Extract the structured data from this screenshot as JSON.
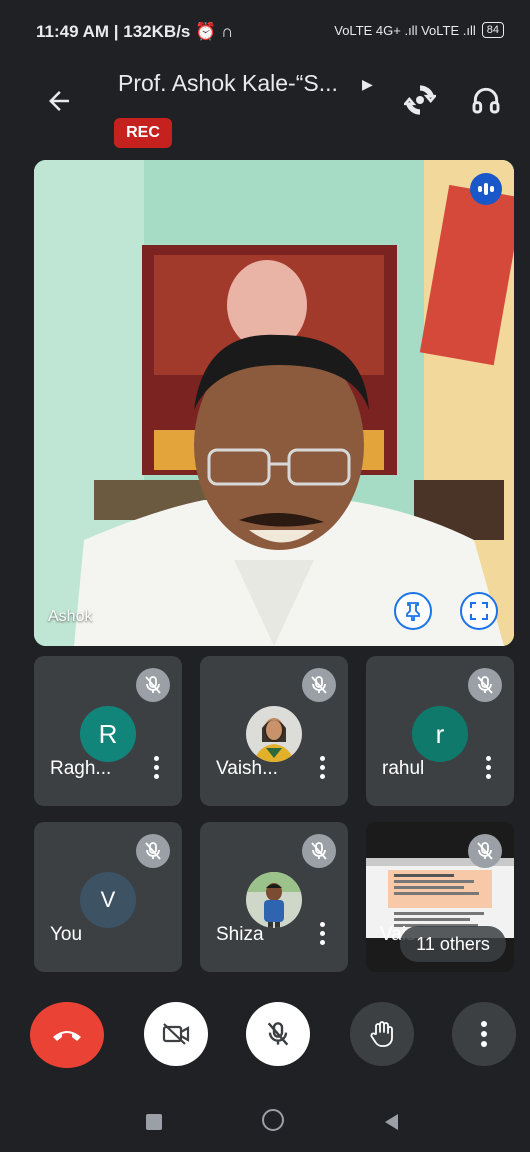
{
  "status_bar": {
    "time_text": "11:49 AM | 132KB/s",
    "network_text": "VoLTE 4G+ .ıll VoLTE .ıll",
    "battery": "84"
  },
  "header": {
    "title": "Prof. Ashok Kale-“S...",
    "rec_label": "REC"
  },
  "main_video": {
    "name": "Ashok"
  },
  "participants": [
    {
      "name": "Ragh...",
      "initial": "R",
      "color": "#12857a"
    },
    {
      "name": "Vaish...",
      "initial": "",
      "color": ""
    },
    {
      "name": "rahul",
      "initial": "r",
      "color": "#0f7a6c"
    },
    {
      "name": "You",
      "initial": "V",
      "color": "#3d5363"
    },
    {
      "name": "Shiza",
      "initial": "",
      "color": ""
    },
    {
      "name": "Vais",
      "others_label": "11 others"
    }
  ],
  "colors": {
    "end_call": "#ea4335",
    "control_bg": "#3c4043",
    "rec": "#c5221f",
    "accent": "#1a73e8"
  }
}
